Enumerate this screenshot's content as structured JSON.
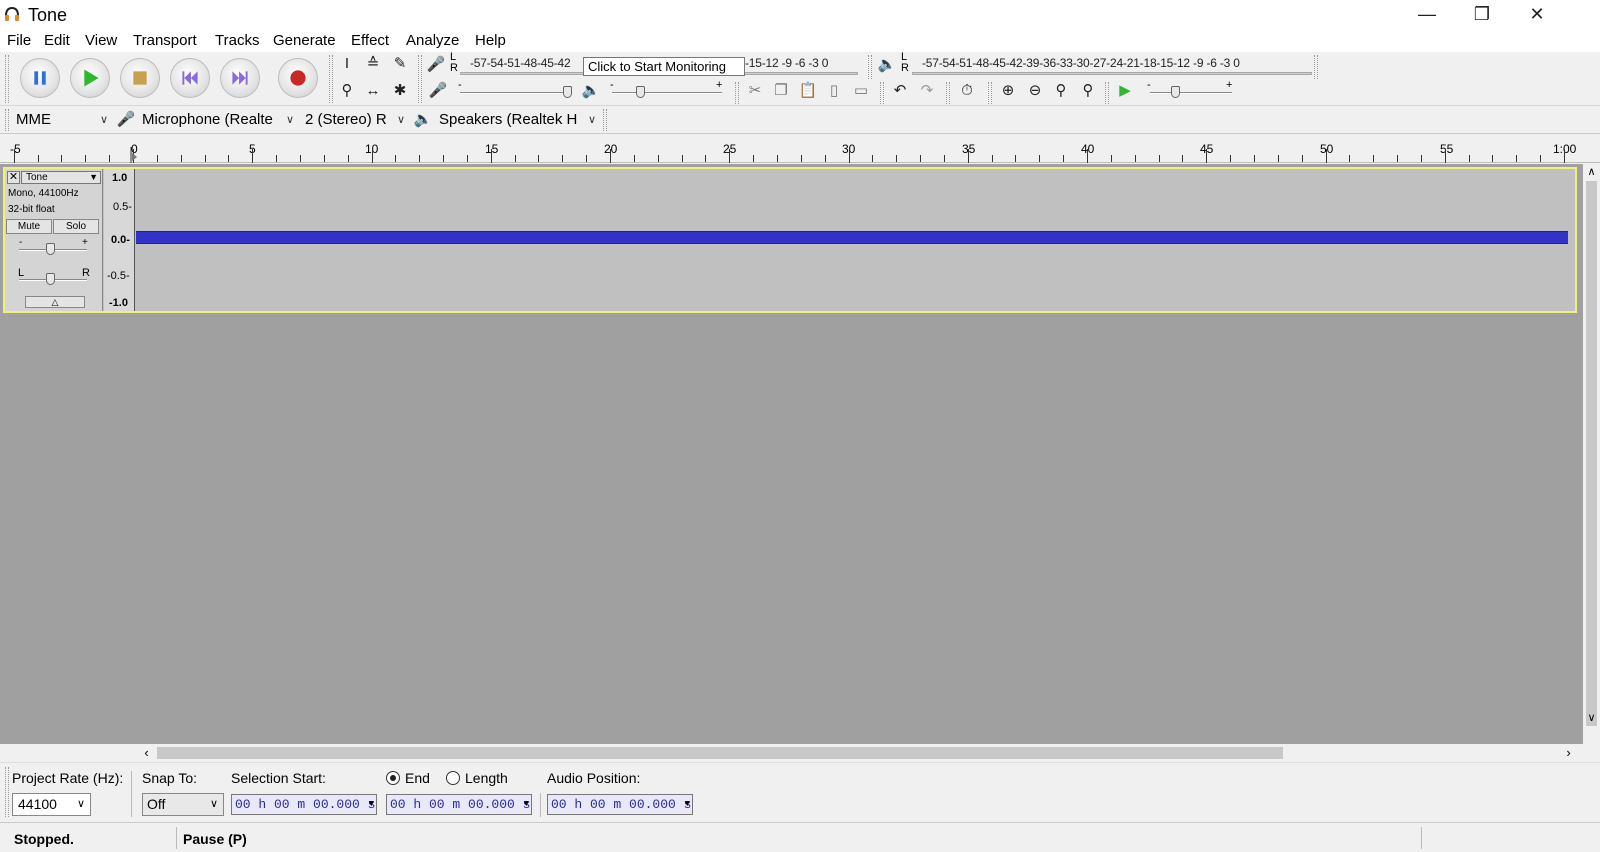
{
  "window": {
    "title": "Tone"
  },
  "menu": [
    "File",
    "Edit",
    "View",
    "Transport",
    "Tracks",
    "Generate",
    "Effect",
    "Analyze",
    "Help"
  ],
  "meters": {
    "record_scale": "-57-54-51-48-45-42",
    "record_scale_right": "18-15-12 -9 -6 -3 0",
    "playback_scale": "-57-54-51-48-45-42-39-36-33-30-27-24-21-18-15-12 -9 -6 -3 0",
    "lr_label_left": "L",
    "lr_label_right": "R",
    "minus": "-",
    "plus": "+"
  },
  "tooltip": "Click to Start Monitoring",
  "devices": {
    "host": "MME",
    "recording_device": "Microphone (Realte",
    "channels": "2 (Stereo) R",
    "playback_device": "Speakers (Realtek H"
  },
  "ruler": {
    "labels": [
      "-5",
      "0",
      "5",
      "10",
      "15",
      "20",
      "25",
      "30",
      "35",
      "40",
      "45",
      "50",
      "55",
      "1:00"
    ]
  },
  "track": {
    "name": "Tone",
    "format_line1": "Mono, 44100Hz",
    "format_line2": "32-bit float",
    "mute": "Mute",
    "solo": "Solo",
    "gain_minus": "-",
    "gain_plus": "+",
    "pan_left": "L",
    "pan_right": "R",
    "scale": [
      "1.0",
      "0.5-",
      "0.0-",
      "-0.5-",
      "-1.0"
    ]
  },
  "selection": {
    "project_rate_label": "Project Rate (Hz):",
    "project_rate_value": "44100",
    "snap_to_label": "Snap To:",
    "snap_to_value": "Off",
    "selection_start_label": "Selection Start:",
    "end_label": "End",
    "length_label": "Length",
    "audio_position_label": "Audio Position:",
    "selection_start_value": "00 h 00 m 00.000 s",
    "end_value": "00 h 00 m 00.000 s",
    "audio_position_value": "00 h 00 m 00.000 s",
    "end_selected": true
  },
  "status": {
    "state": "Stopped.",
    "hint": "Pause (P)"
  },
  "colors": {
    "waveform": "#3232c8",
    "track_border": "#f0f07a",
    "play_green": "#2db82d",
    "record_red": "#c82828"
  }
}
